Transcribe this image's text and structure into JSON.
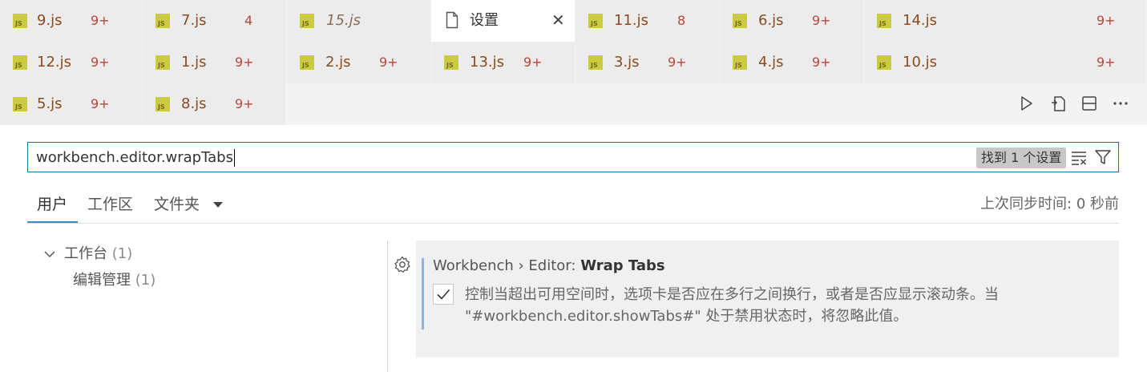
{
  "tabs": [
    {
      "name": "9.js",
      "badge": "9+"
    },
    {
      "name": "7.js",
      "badge": "4"
    },
    {
      "name": "15.js",
      "badge": ""
    },
    {
      "name": "设置",
      "active": true
    },
    {
      "name": "11.js",
      "badge": "8"
    },
    {
      "name": "6.js",
      "badge": "9+"
    },
    {
      "name": "14.js",
      "badge": "9+"
    },
    {
      "name": "12.js",
      "badge": "9+"
    },
    {
      "name": "1.js",
      "badge": "9+"
    },
    {
      "name": "2.js",
      "badge": "9+"
    },
    {
      "name": "13.js",
      "badge": "9+"
    },
    {
      "name": "3.js",
      "badge": "9+"
    },
    {
      "name": "4.js",
      "badge": "9+"
    },
    {
      "name": "10.js",
      "badge": "9+"
    },
    {
      "name": "5.js",
      "badge": "9+"
    },
    {
      "name": "8.js",
      "badge": "9+"
    }
  ],
  "js_icon_text": "JS",
  "search": {
    "value": "workbench.editor.wrapTabs",
    "result_count": "找到 1 个设置"
  },
  "scopes": {
    "user": "用户",
    "workspace": "工作区",
    "folder": "文件夹",
    "sync_status": "上次同步时间: 0 秒前"
  },
  "tree": {
    "group_label": "工作台",
    "group_count": "(1)",
    "child_label": "编辑管理",
    "child_count": "(1)"
  },
  "setting": {
    "category": "Workbench › Editor: ",
    "name": "Wrap Tabs",
    "checked": true,
    "description": "控制当超出可用空间时，选项卡是否应在多行之间换行，或者是否应显示滚动条。当 \"#workbench.editor.showTabs#\" 处于禁用状态时，将忽略此值。"
  },
  "colors": {
    "accent": "#0e7a9c",
    "badge": "#b5473c",
    "js_icon": "#cbcb41"
  }
}
